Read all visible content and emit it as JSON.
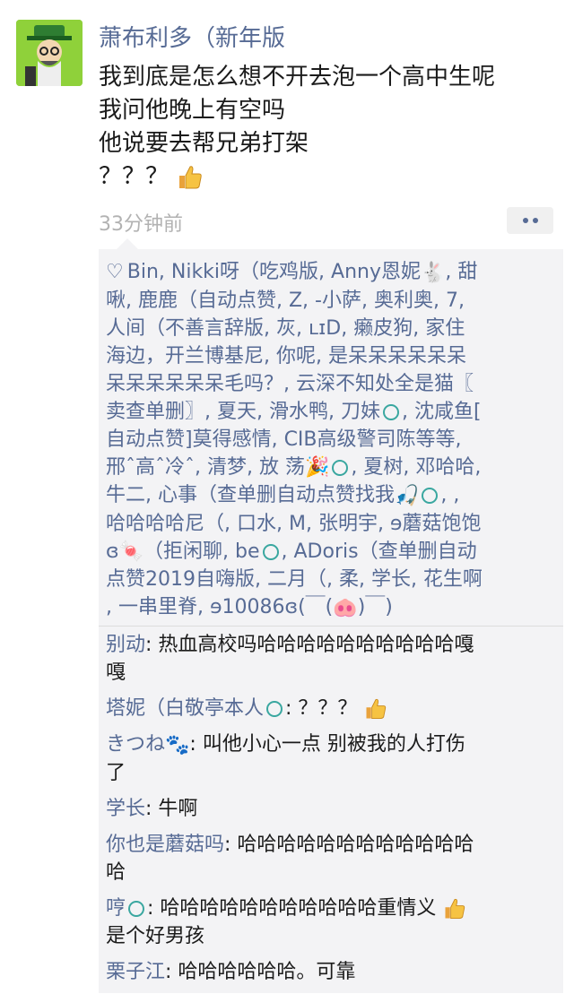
{
  "post": {
    "author": "萧布利多（新年版",
    "lines": [
      "我到底是怎么想不开去泡一个高中生呢",
      "我问他晚上有空吗",
      "他说要去帮兄弟打架",
      "？？？"
    ],
    "time": "33分钟前"
  },
  "likes": {
    "lines": [
      "Bin, Nikki呀（吃鸡版, Anny恩妮",
      ", 甜",
      "啾, 鹿鹿（自动点赞, Z, -小萨, 奥利奥, 7,",
      "人间（不善言辞版, 灰, ʟɪD, 癞皮狗, 家住",
      "海边，开兰博基尼, 你呢, 是呆呆呆呆呆呆",
      "呆呆呆呆呆呆毛吗？, 云深不知处全是猫〖",
      "卖查单删〗, 夏天, 滑水鸭, 刀妹",
      ", 沈咸鱼[",
      "自动点赞]莫得感情, CIB高级警司陈等等,",
      "邢ˆ高ˆ冷ˆ, 清梦, 放 荡",
      ", 夏树, 邓哈哈,",
      "牛二, 心事（查单删自动点赞找我",
      ", ,",
      "哈哈哈哈尼（, 口水, M, 张明宇, ɘ蘑菇饱饱",
      "ɞ",
      "（拒闲聊, be",
      ", ADoris（查单删自动",
      "点赞2019自嗨版, 二月（, 柔, 学长, 花生啊",
      ", 一串里脊, ɘ10086ɞ(￣(",
      ")￣)"
    ]
  },
  "comments": [
    {
      "name": "别动",
      "text": ": 热血高校吗哈哈哈哈哈哈哈哈哈哈嘎",
      "cont": "嘎"
    },
    {
      "name": "塔妮（白敬亭本人",
      "text": ": ？？？",
      "cont": ""
    },
    {
      "name": "きつね",
      "text": ": 叫他小心一点 别被我的人打伤",
      "cont": "了"
    },
    {
      "name": "学长",
      "text": ": 牛啊",
      "cont": ""
    },
    {
      "name": "你也是蘑菇吗",
      "text": ": 哈哈哈哈哈哈哈哈哈哈哈哈",
      "cont": "哈"
    },
    {
      "name": "哼",
      "text": ": 哈哈哈哈哈哈哈哈哈哈哈重情义",
      "cont": "是个好男孩"
    },
    {
      "name": "栗子江",
      "text": ": 哈哈哈哈哈哈。可靠",
      "cont": ""
    }
  ]
}
